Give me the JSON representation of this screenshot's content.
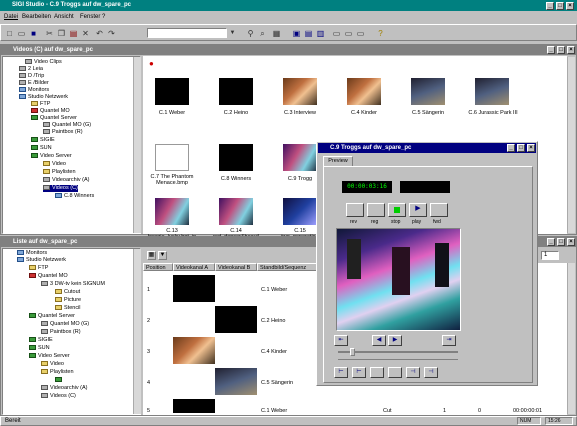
{
  "app": {
    "title": "SIGI Studio - C.9 Troggs auf dw_spare_pc"
  },
  "menu": [
    "Datei",
    "Bearbeiten",
    "Ansicht",
    "Fenster",
    "?"
  ],
  "toolbar": {
    "search_value": ""
  },
  "top_window": {
    "title": "Videos (C) auf dw_spare_pc",
    "tree": [
      "Video Clips",
      "2 Leia",
      "D /Trip",
      "E /Bilder",
      "Monitors",
      "Studio Netzwerk",
      "FTP",
      "Quantel MO",
      "Quantel Server",
      "Quantel MO (G)",
      "Paintbox (R)",
      "SIGIE",
      "SUN",
      "Video Server",
      "Video",
      "Playlisten",
      "Videoarchiv (A)",
      "Videos (C)",
      "C.8 Winners"
    ],
    "thumbs": [
      "C.1 Weber",
      "C.2 Heino",
      "C.3 Interview",
      "C.4 Kinder",
      "C.5 Sängerin",
      "C.6 Jurassic Park III",
      "C.7 The Phantom Menace.bmp",
      "C.8 Winners",
      "C.9 Trogg",
      "",
      "C.13 boogie_lucky.bot_in_1",
      "C.14 red_dancer&heavil",
      "C.15 two_generation"
    ]
  },
  "bottom_window": {
    "title": "Liste auf dw_spare_pc",
    "tree": [
      "Monitors",
      "Studio Netzwerk",
      "FTP",
      "Quantel MO",
      "3 DW-tv kein SIGNUM",
      "Cutout",
      "Picture",
      "Stencil",
      "Quantel Server",
      "Quantel MO (G)",
      "Paintbox (R)",
      "SIGIE",
      "SUN",
      "Video Server",
      "Video",
      "Playlisten",
      "",
      "Videoarchiv (A)",
      "Videos (C)"
    ],
    "columns": [
      "Position",
      "Videokanal A",
      "Videokanal B",
      "Standbild/Sequenz"
    ],
    "rows": [
      {
        "num": "1",
        "label": "C.1 Weber"
      },
      {
        "num": "2",
        "label": "C.2 Heino"
      },
      {
        "num": "3",
        "label": "C.4 Kinder"
      },
      {
        "num": "4",
        "label": "C.5 Sängerin"
      },
      {
        "num": "5",
        "label": "C.1 Weber",
        "extra": "Cut",
        "n1": "1",
        "n2": "0",
        "tc": "00:00:00:01"
      }
    ],
    "page_field": "1"
  },
  "preview": {
    "title": "C.9 Troggs auf dw_spare_pc",
    "tab": "Preview",
    "timecode": "00:00:03:16",
    "transport_labels": [
      "rev",
      "reg",
      "stop",
      "play",
      "fwd"
    ]
  },
  "statusbar": {
    "left": "Bereit",
    "right1": "NUM",
    "right2": "15:26"
  },
  "colors": {
    "title_active": "#000080",
    "title_inactive": "#808080",
    "timecode": "#00ff00"
  }
}
